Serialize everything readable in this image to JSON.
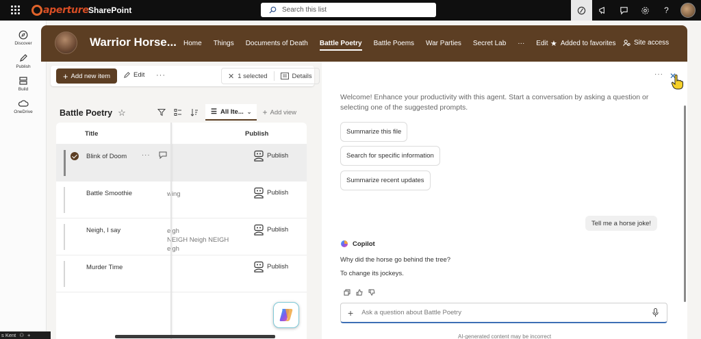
{
  "topbar": {
    "logo_text": "aperture",
    "app_name": "SharePoint",
    "search_placeholder": "Search this list",
    "icons": [
      "waffle-icon",
      "copilot-icon",
      "megaphone-icon",
      "feedback-icon",
      "gear-icon",
      "help-icon",
      "user-avatar"
    ]
  },
  "rail": {
    "items": [
      {
        "label": "Discover",
        "icon": "compass-icon"
      },
      {
        "label": "Publish",
        "icon": "pen-icon"
      },
      {
        "label": "Build",
        "icon": "layout-icon"
      },
      {
        "label": "OneDrive",
        "icon": "cloud-icon"
      }
    ]
  },
  "site": {
    "title": "Warrior Horse...",
    "nav": [
      "Home",
      "Things",
      "Documents of Death",
      "Battle Poetry",
      "Battle Poems",
      "War Parties",
      "Secret Lab",
      "···",
      "Edit"
    ],
    "active_nav": "Battle Poetry",
    "favorites_label": "Added to favorites",
    "site_access_label": "Site access",
    "brand_color": "#5c3e23"
  },
  "commandbar": {
    "new_item": "Add new item",
    "edit": "Edit",
    "more": "···",
    "selected": "1 selected",
    "details": "Details"
  },
  "list": {
    "title": "Battle Poetry",
    "view_name": "All Ite...",
    "add_view": "Add view",
    "columns": {
      "title": "Title",
      "publish": "Publish"
    },
    "rows": [
      {
        "title": "Blink of Doom",
        "extra": [
          "",
          "",
          ""
        ],
        "publish": "Publish",
        "selected": true
      },
      {
        "title": "Battle Smoothie",
        "extra": [
          "",
          "wing",
          ""
        ],
        "publish": "Publish",
        "selected": false
      },
      {
        "title": "Neigh, I say",
        "extra": [
          "eigh",
          "NEIGH Neigh NEIGH",
          "eigh"
        ],
        "publish": "Publish",
        "selected": false
      },
      {
        "title": "Murder Time",
        "extra": [
          "",
          "",
          ""
        ],
        "publish": "Publish",
        "selected": false
      }
    ]
  },
  "bottom_strip": {
    "user": "s Kent",
    "plus": "+"
  },
  "copilot": {
    "welcome": "Welcome! Enhance your productivity with this agent. Start a conversation by asking a question or selecting one of the suggested prompts.",
    "suggestions": [
      "Summarize this file",
      "Search for specific information",
      "Summarize recent updates"
    ],
    "user_message": "Tell me a horse joke!",
    "assistant_name": "Copilot",
    "assistant_lines": [
      "Why did the horse go behind the tree?",
      "To change its jockeys."
    ],
    "ask_placeholder": "Ask a question about Battle Poetry",
    "disclaimer": "AI-generated content may be incorrect",
    "more": "···",
    "close": "✕"
  }
}
